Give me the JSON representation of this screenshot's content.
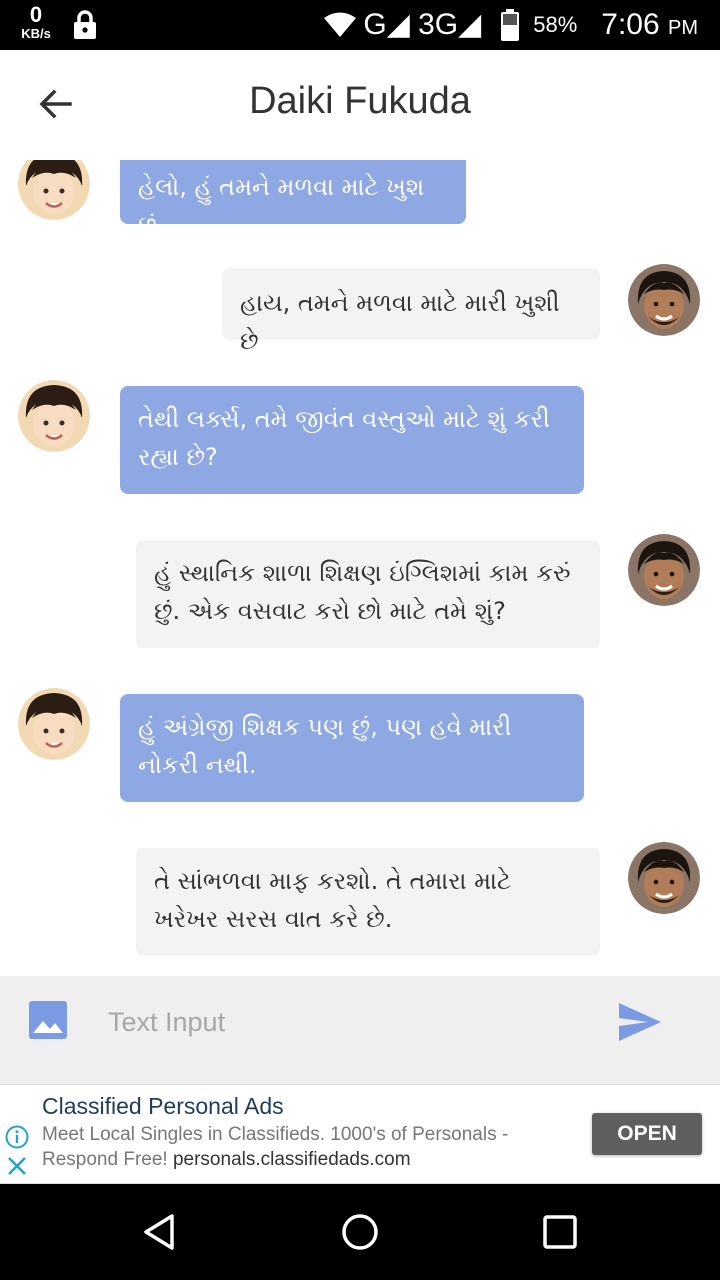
{
  "status_bar": {
    "speed_value": "0",
    "speed_unit": "KB/s",
    "network": "G◢ 3G◢",
    "battery": "58%",
    "time": "7:06",
    "ampm": "PM"
  },
  "header": {
    "title": "Daiki Fukuda"
  },
  "messages": [
    {
      "from": "other",
      "text": "હેલો, હું તમને મળવા માટે ખુશ છું"
    },
    {
      "from": "me",
      "text": "હાય, તમને મળવા માટે મારી ખુશી છે"
    },
    {
      "from": "other",
      "text": "તેથી લર્ક્સ, તમે જીવંત વસ્તુઓ માટે શું કરી રહ્યા છે?"
    },
    {
      "from": "me",
      "text": "હું સ્થાનિક શાળા શિક્ષણ ઇંગ્લિશમાં કામ કરું છું. એક વસવાટ કરો છો માટે તમે શું?"
    },
    {
      "from": "other",
      "text": "હું અંગ્રેજી શિક્ષક પણ છું, પણ હવે મારી નોકરી નથી."
    },
    {
      "from": "me",
      "text": "તે સાંભળવા માફ કરશો. તે તમારા માટે ખરેખર સરસ વાત કરે છે."
    }
  ],
  "composer": {
    "placeholder": "Text Input",
    "value": ""
  },
  "ad": {
    "title": "Classified Personal Ads",
    "body": "Meet Local Singles in Classifieds. 1000's of Personals - Respond Free!",
    "url": "personals.classifiedads.com",
    "cta": "OPEN"
  },
  "colors": {
    "incoming_bubble": "#8ea8e3",
    "outgoing_bubble": "#f3f3f3",
    "accent": "#7a9be3"
  }
}
